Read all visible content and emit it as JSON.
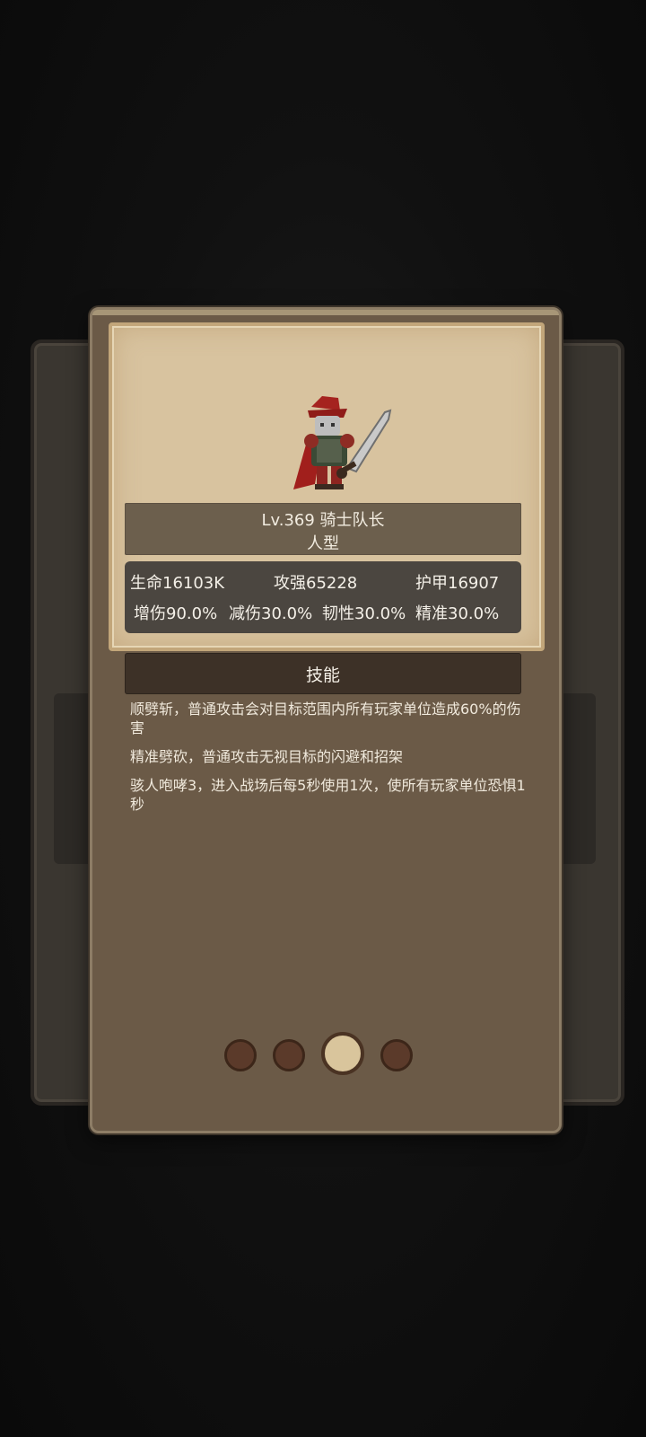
{
  "monster": {
    "title_line": "Lv.369 骑士队长",
    "type_line": "人型"
  },
  "stats": {
    "hp": "生命16103K",
    "attack": "攻强65228",
    "armor": "护甲16907",
    "dmg_up": "增伤90.0%",
    "dmg_down": "减伤30.0%",
    "toughness": "韧性30.0%",
    "accuracy": "精准30.0%"
  },
  "skills_header": "技能",
  "skills": [
    "顺劈斩，普通攻击会对目标范围内所有玩家单位造成60%的伤害",
    "精准劈砍，普通攻击无视目标的闪避和招架",
    "骇人咆哮3，进入战场后每5秒使用1次，使所有玩家单位恐惧1秒"
  ],
  "pager": {
    "total": 4,
    "current": 3
  },
  "colors": {
    "dialog_bg": "#6b5a47",
    "card_bg": "#d8c39f",
    "stats_bg": "#4b4640",
    "skill_header_bg": "#3d3127",
    "dot_active": "#d9c59c",
    "dot_inactive": "#5b3a2a"
  }
}
